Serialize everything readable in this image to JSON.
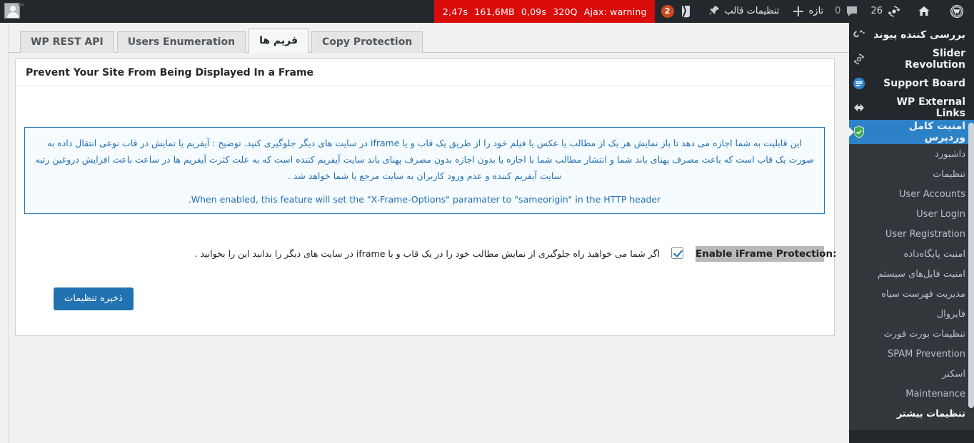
{
  "adminbar": {
    "avatar_name": "user-avatar",
    "querymonitor": {
      "time": "2,47s",
      "memory": "161,6MB",
      "db_time": "0,09s",
      "queries": "320Q",
      "ajax": "Ajax: warning"
    },
    "yoast_badge": "2",
    "items": [
      {
        "label": "تنظیمات قالب",
        "icon": "pin-icon",
        "rtl": true
      },
      {
        "label": "تازه",
        "icon": "plus-icon",
        "rtl": true
      },
      {
        "label": "0",
        "icon": "comment-icon",
        "rtl": false
      },
      {
        "label": "26",
        "icon": "updates-icon",
        "rtl": false
      }
    ],
    "home_icon": "home-icon",
    "wp_logo_icon": "wordpress-logo-icon"
  },
  "adminmenu": {
    "top_items": [
      {
        "label": "بررسی کننده پیوند",
        "icon": "link-checker-icon",
        "current": false
      },
      {
        "label": "Slider Revolution",
        "icon": "slider-revolution-icon",
        "current": false
      },
      {
        "label": "Support Board",
        "icon": "support-board-icon",
        "current": false
      },
      {
        "label": "WP External Links",
        "icon": "external-links-icon",
        "current": false
      },
      {
        "label": "امنیت کامل وردپرس",
        "icon": "shield-icon",
        "current": true
      }
    ],
    "submenu": [
      {
        "label": "داشبورد",
        "current": false
      },
      {
        "label": "تنظیمات",
        "current": false
      },
      {
        "label": "User Accounts",
        "current": false
      },
      {
        "label": "User Login",
        "current": false
      },
      {
        "label": "User Registration",
        "current": false
      },
      {
        "label": "امنیت پایگاه‌داده",
        "current": false
      },
      {
        "label": "امنیت فایل‌های سیستم",
        "current": false
      },
      {
        "label": "مدیریت فهرست سیاه",
        "current": false
      },
      {
        "label": "فایروال",
        "current": false
      },
      {
        "label": "تنظیمات بورت فورث",
        "current": false
      },
      {
        "label": "SPAM Prevention",
        "current": false
      },
      {
        "label": "اسکنر",
        "current": false
      },
      {
        "label": "Maintenance",
        "current": false
      },
      {
        "label": "تنظیمات بیشتر",
        "current": true
      }
    ]
  },
  "tabs": [
    {
      "label": "WP REST API",
      "active": false,
      "rtl": false
    },
    {
      "label": "Users Enumeration",
      "active": false,
      "rtl": false
    },
    {
      "label": "فریم ها",
      "active": true,
      "rtl": true
    },
    {
      "label": "Copy Protection",
      "active": false,
      "rtl": false
    }
  ],
  "panel": {
    "title": "Prevent Your Site From Being Displayed In a Frame",
    "info_fa": "این قابلیت به شما اجازه می دهد تا باز نمایش هر یک از مطالب یا عکس یا فیلم خود را از طریق یک قاب و یا iframe در سایت های دیگر جلوگیری کنید. توضیح : آیفریم یا نمایش در قاب نوعی انتقال داده به صورت یک قاب است که باعث مصرف پهنای باند شما و انتشار مطالب شما با اجازه یا بدون اجازه بدون مصرف پهنای باند سایت آیفریم کننده است که به علت کثرت آیفریم ها در ساعت باعث افزایش دروغین رتبه سایت آیفریم کننده و عدم ورود کاربران به سایت مرجع یا شما خواهد شد .",
    "info_en": ".When enabled, this feature will set the \"X-Frame-Options\" paramater to \"sameorigin\" in the HTTP header",
    "field_label": "Enable iFrame Protection:",
    "checkbox_checked": true,
    "checkbox_description": "اگر شما می خواهید راه جلوگیری از نمایش مطالب خود را در یک قاب و یا iframe در سایت های دیگر را بدانید این را بخوانید .",
    "save_label": "ذخیره تنظیمات"
  },
  "colors": {
    "admin_bar_bg": "#23282d",
    "menu_current_bg": "#2d82c7",
    "info_border": "#2271b1",
    "info_bg": "#f5fbff",
    "info_text": "#2471b4",
    "primary_button": "#2271b1",
    "query_monitor_bg": "#da0b0b"
  }
}
